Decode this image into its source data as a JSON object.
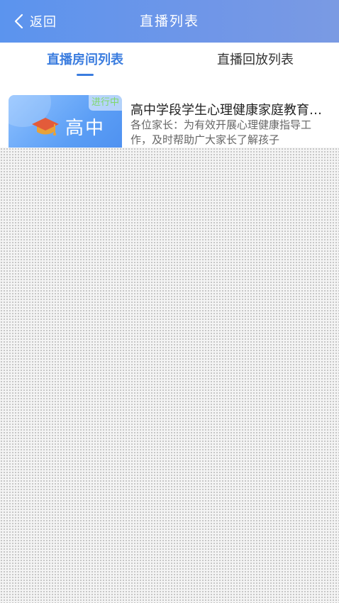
{
  "header": {
    "back_label": "返回",
    "title": "直播列表"
  },
  "tabs": [
    {
      "label": "直播房间列表",
      "active": true
    },
    {
      "label": "直播回放列表",
      "active": false
    }
  ],
  "colors": {
    "accent": "#3b7ddf",
    "header_start": "#5b94ee",
    "header_end": "#7a9ae3",
    "live_badge": "#7fd86a"
  },
  "live_rooms": [
    {
      "status_badge": "进行中",
      "grade_label": "高中",
      "icon": "graduation-cap-icon",
      "title": "高中学段学生心理健康家庭教育指导直播",
      "description": "各位家长：为有效开展心理健康指导工作，及时帮助广大家长了解孩子"
    }
  ]
}
